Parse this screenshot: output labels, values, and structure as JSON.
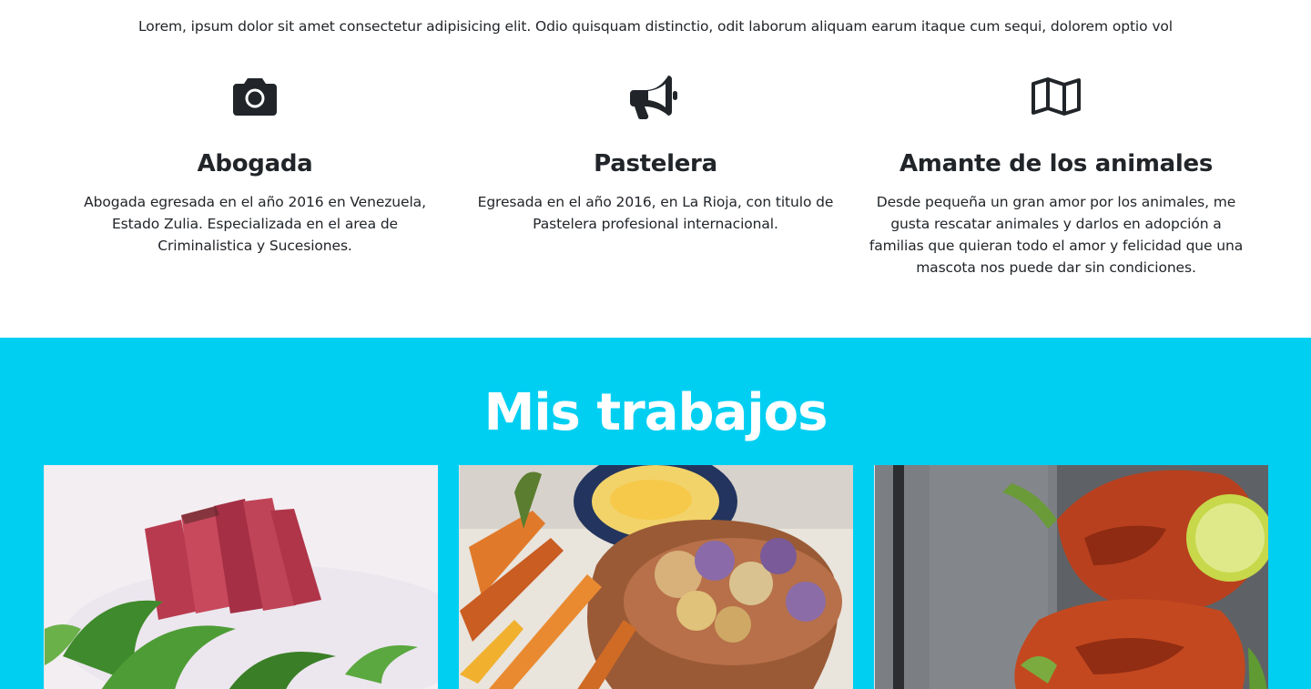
{
  "intro": {
    "text": "Lorem, ipsum dolor sit amet consectetur adipisicing elit. Odio quisquam distinctio, odit laborum aliquam earum itaque cum sequi, dolorem optio vol"
  },
  "features": [
    {
      "icon": "camera-icon",
      "title": "Abogada",
      "description": "Abogada egresada en el año 2016 en Venezuela, Estado Zulia. Especializada en el area de Criminalistica y Sucesiones."
    },
    {
      "icon": "bullhorn-icon",
      "title": "Pastelera",
      "description": "Egresada en el año 2016, en La Rioja, con titulo de Pastelera profesional internacional."
    },
    {
      "icon": "map-icon",
      "title": "Amante de los animales",
      "description": "Desde pequeña un gran amor por los animales, me gusta rescatar animales y darlos en adopción a familias que quieran todo el amor y felicidad que una mascota nos puede dar sin condiciones."
    }
  ],
  "works": {
    "title": "Mis trabajos",
    "items": [
      {
        "image": "seared-tuna-photo"
      },
      {
        "image": "roasted-vegetables-chips-photo"
      },
      {
        "image": "glazed-salmon-photo"
      }
    ]
  },
  "colors": {
    "accent": "#00cff2",
    "text": "#212529",
    "heading_on_accent": "#ffffff"
  }
}
